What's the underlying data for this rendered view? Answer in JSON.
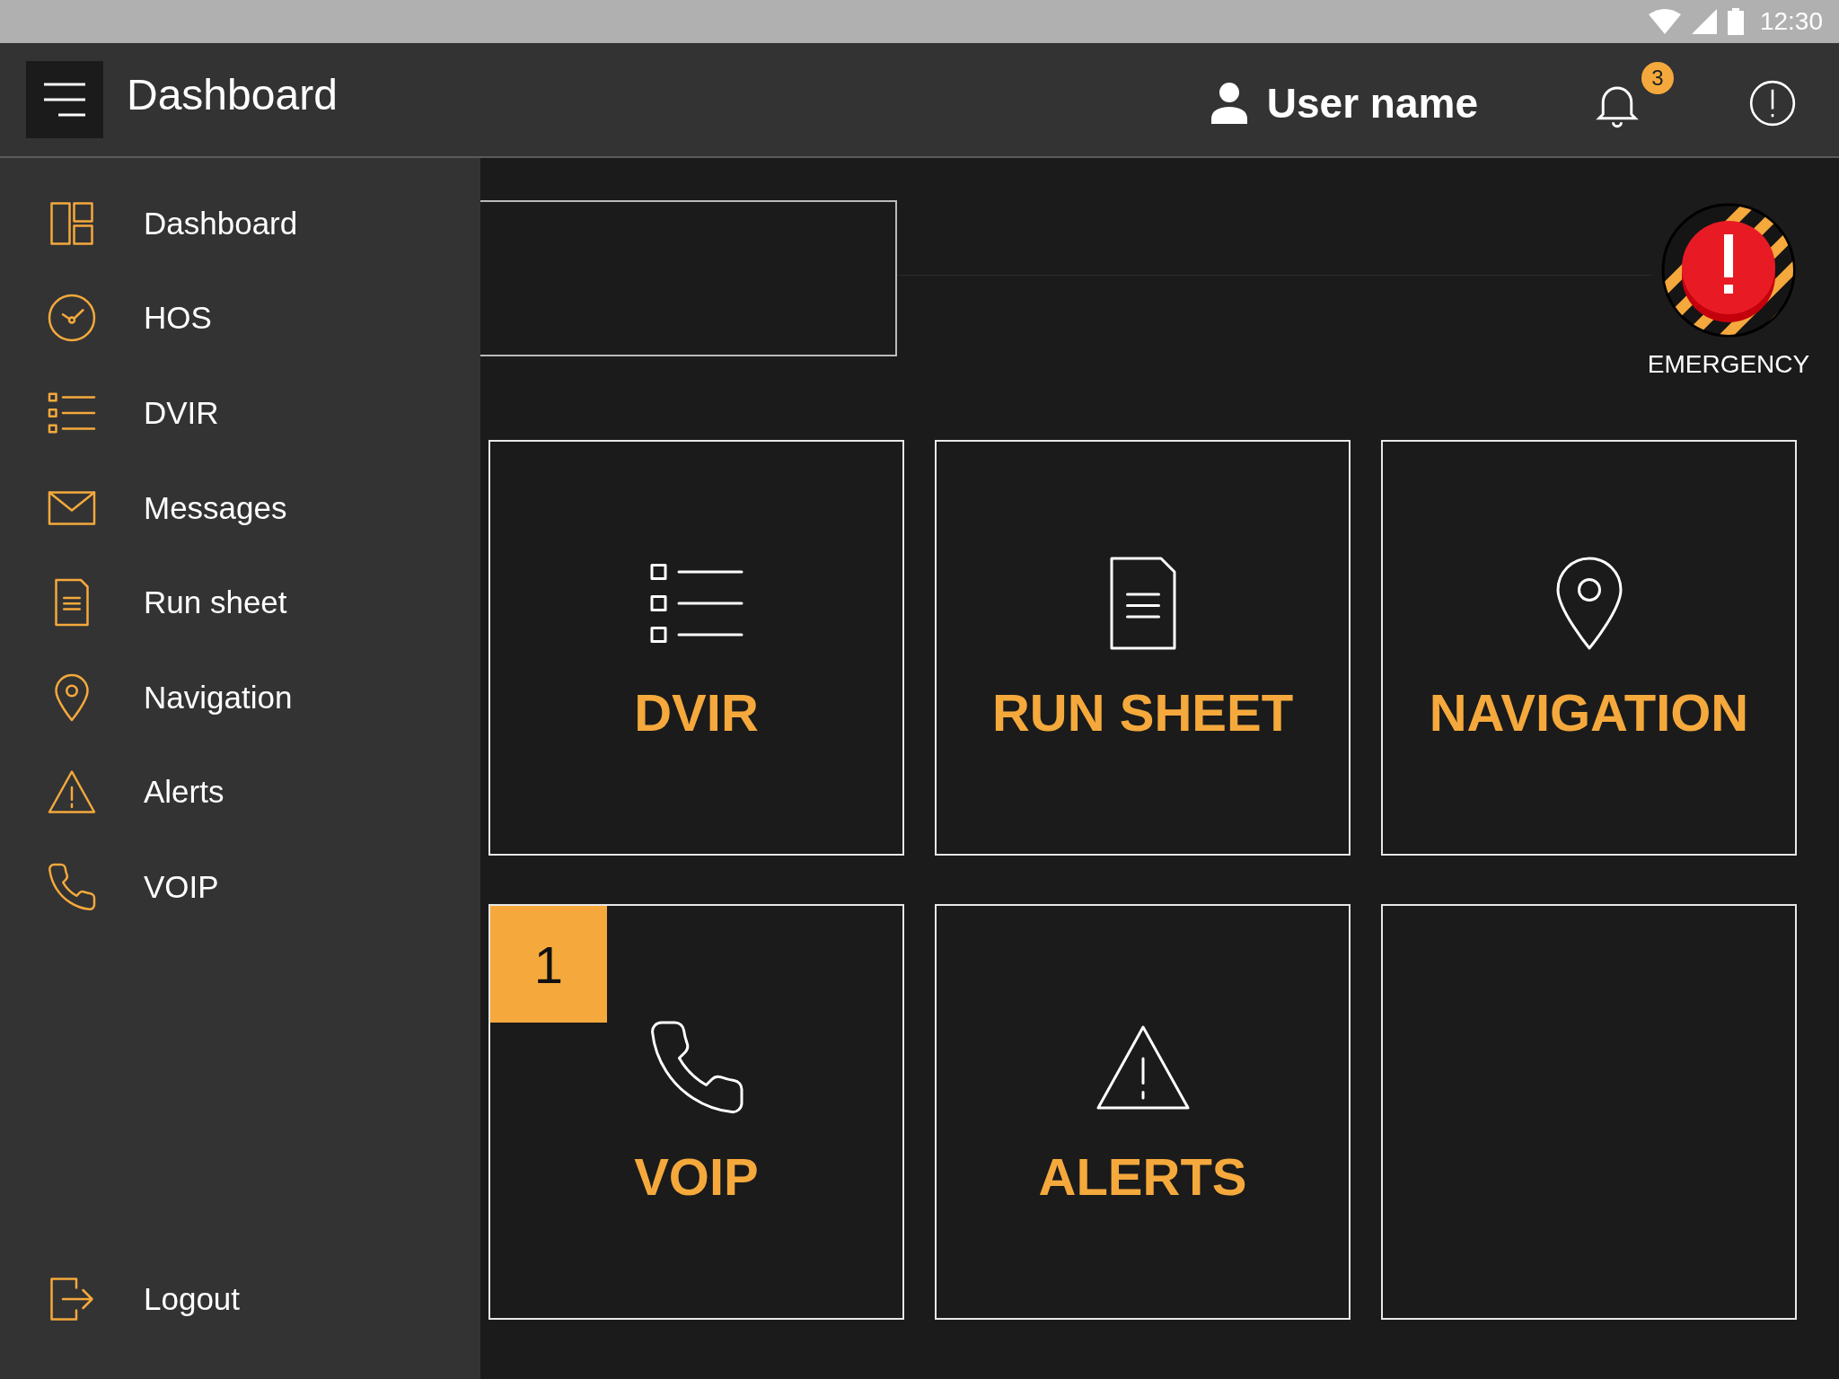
{
  "status_bar": {
    "time": "12:30"
  },
  "header": {
    "title": "Dashboard",
    "user_name": "User name",
    "notification_count": "3"
  },
  "sidebar": {
    "items": [
      {
        "label": "Dashboard",
        "kind": "dashboard"
      },
      {
        "label": "HOS",
        "kind": "clock"
      },
      {
        "label": "DVIR",
        "kind": "checklist"
      },
      {
        "label": "Messages",
        "kind": "envelope"
      },
      {
        "label": "Run sheet",
        "kind": "document"
      },
      {
        "label": "Navigation",
        "kind": "pin"
      },
      {
        "label": "Alerts",
        "kind": "warning"
      },
      {
        "label": "VOIP",
        "kind": "phone"
      }
    ],
    "footer_item": {
      "label": "Logout",
      "kind": "logout"
    }
  },
  "emergency": {
    "label": "EMERGENCY"
  },
  "tiles": [
    {
      "label": "DVIR",
      "kind": "checklist"
    },
    {
      "label": "RUN SHEET",
      "kind": "document"
    },
    {
      "label": "NAVIGATION",
      "kind": "pin"
    },
    {
      "label": "VOIP",
      "kind": "phone",
      "badge": "1"
    },
    {
      "label": "ALERTS",
      "kind": "warning"
    },
    {
      "kind": "blank"
    }
  ]
}
